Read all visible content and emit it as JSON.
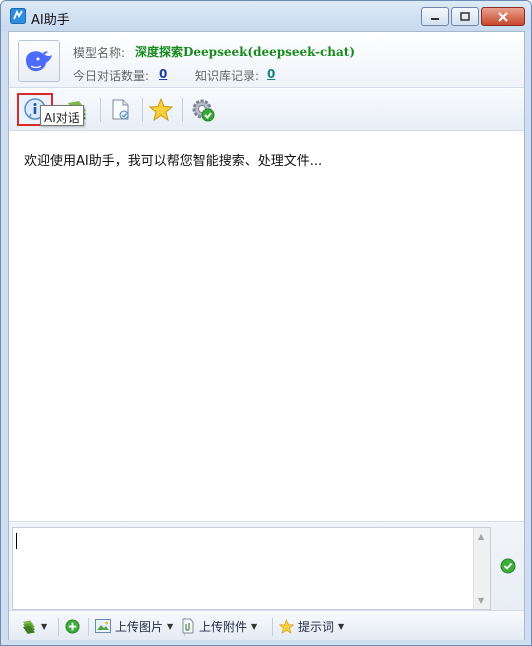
{
  "window": {
    "title": "AI助手"
  },
  "header": {
    "model_label": "模型名称:",
    "model_name": "深度探索Deepseek(deepseek-chat)",
    "today_count_label": "今日对话数量:",
    "today_count": "0",
    "kb_label": "知识库记录:",
    "kb_count": "0"
  },
  "toolbar": {
    "tooltip": "AI对话",
    "buttons": [
      "info-icon",
      "bookmark-stack-icon",
      "document-refresh-icon",
      "star-icon",
      "settings-check-icon"
    ]
  },
  "chat": {
    "welcome": "欢迎使用AI助手，我可以帮您智能搜索、处理文件..."
  },
  "input": {
    "value": ""
  },
  "bottom_bar": {
    "upload_image": "上传图片",
    "upload_attachment": "上传附件",
    "prompt_words": "提示词"
  },
  "colors": {
    "model_name": "#178a1c",
    "count": "#1a3fa3",
    "tooltip_highlight": "#d52b2b"
  }
}
